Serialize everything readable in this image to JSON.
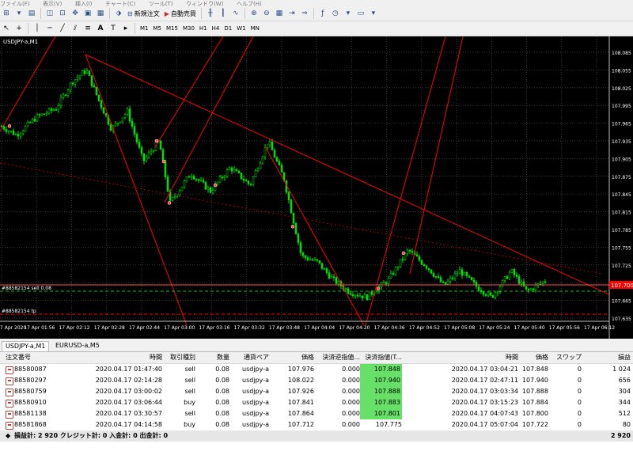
{
  "menu": [
    "ファイル(F)",
    "表示(V)",
    "挿入(I)",
    "チャート(C)",
    "ツール(T)",
    "ウィンドウ(W)",
    "ヘルプ(H)"
  ],
  "toolbar": {
    "new_order_label": "新規注文",
    "auto_trade_label": "自動売買",
    "timeframes": [
      "M1",
      "M5",
      "M15",
      "M30",
      "H1",
      "H4",
      "D1",
      "W1",
      "MN"
    ]
  },
  "chart": {
    "symbol_label": "USDJPY-a,M1",
    "current_price": "107.700",
    "order_line_label": "#88582154 sell 0.08",
    "tp_line_label": "#88582154 tp",
    "price_ticks": [
      "108.085",
      "108.055",
      "108.025",
      "107.995",
      "107.965",
      "107.935",
      "107.905",
      "107.875",
      "107.845",
      "107.815",
      "107.785",
      "107.755",
      "107.725",
      "107.695",
      "107.665",
      "107.635"
    ],
    "time_ticks": [
      "7 Apr 2020",
      "17 Apr 01:56",
      "17 Apr 02:12",
      "17 Apr 02:28",
      "17 Apr 02:44",
      "17 Apr 03:00",
      "17 Apr 03:16",
      "17 Apr 03:32",
      "17 Apr 03:48",
      "17 Apr 04:04",
      "17 Apr 04:20",
      "17 Apr 04:36",
      "17 Apr 04:52",
      "17 Apr 05:08",
      "17 Apr 05:24",
      "17 Apr 05:40",
      "17 Apr 05:56",
      "17 Apr 06:12"
    ],
    "colors": {
      "background": "#000000",
      "candle": "#00e000",
      "grid": "#3a3a3a",
      "trendline": "#ff0000",
      "price_badge": "#ff0000"
    }
  },
  "tabs": [
    {
      "label": "USDJPY-a,M1",
      "active": true
    },
    {
      "label": "EURUSD-a,M5",
      "active": false
    }
  ],
  "orders": {
    "headers": {
      "order": "注文番号",
      "time": "時間",
      "type": "取引種別",
      "volume": "数量",
      "symbol": "通貨ペア",
      "price": "価格",
      "sl": "決済逆指値...",
      "tp": "決済指値(T...",
      "close_time": "時間",
      "close_price": "価格",
      "swap": "スワップ",
      "profit": "損益"
    },
    "rows": [
      {
        "order": "88580087",
        "time": "2020.04.17 01:47:40",
        "type": "sell",
        "volume": "0.08",
        "symbol": "usdjpy-a",
        "price": "107.976",
        "sl": "0.000",
        "tp": "107.848",
        "tp_hit": true,
        "close_time": "2020.04.17 03:04:21",
        "close_price": "107.848",
        "swap": "0",
        "profit": "1 024"
      },
      {
        "order": "88580297",
        "time": "2020.04.17 02:14:28",
        "type": "sell",
        "volume": "0.08",
        "symbol": "usdjpy-a",
        "price": "108.022",
        "sl": "0.000",
        "tp": "107.940",
        "tp_hit": true,
        "close_time": "2020.04.17 02:47:11",
        "close_price": "107.940",
        "swap": "0",
        "profit": "656"
      },
      {
        "order": "88580759",
        "time": "2020.04.17 03:00:02",
        "type": "sell",
        "volume": "0.08",
        "symbol": "usdjpy-a",
        "price": "107.926",
        "sl": "0.000",
        "tp": "107.888",
        "tp_hit": true,
        "close_time": "2020.04.17 03:03:34",
        "close_price": "107.888",
        "swap": "0",
        "profit": "304"
      },
      {
        "order": "88580910",
        "time": "2020.04.17 03:06:44",
        "type": "buy",
        "volume": "0.08",
        "symbol": "usdjpy-a",
        "price": "107.841",
        "sl": "0.000",
        "tp": "107.883",
        "tp_hit": true,
        "close_time": "2020.04.17 03:15:23",
        "close_price": "107.884",
        "swap": "0",
        "profit": "344"
      },
      {
        "order": "88581138",
        "time": "2020.04.17 03:30:57",
        "type": "sell",
        "volume": "0.08",
        "symbol": "usdjpy-a",
        "price": "107.864",
        "sl": "0.000",
        "tp": "107.801",
        "tp_hit": true,
        "close_time": "2020.04.17 04:07:43",
        "close_price": "107.800",
        "swap": "0",
        "profit": "512"
      },
      {
        "order": "88581868",
        "time": "2020.04.17 04:14:58",
        "type": "buy",
        "volume": "0.08",
        "symbol": "usdjpy-a",
        "price": "107.712",
        "sl": "0.000",
        "tp": "107.775",
        "tp_hit": false,
        "close_time": "2020.04.17 05:07:04",
        "close_price": "107.722",
        "swap": "0",
        "profit": "80"
      }
    ],
    "total_label": "損益計: 2 920  クレジット計: 0  入金計: 0  出金計: 0",
    "total_value": "2 920"
  }
}
